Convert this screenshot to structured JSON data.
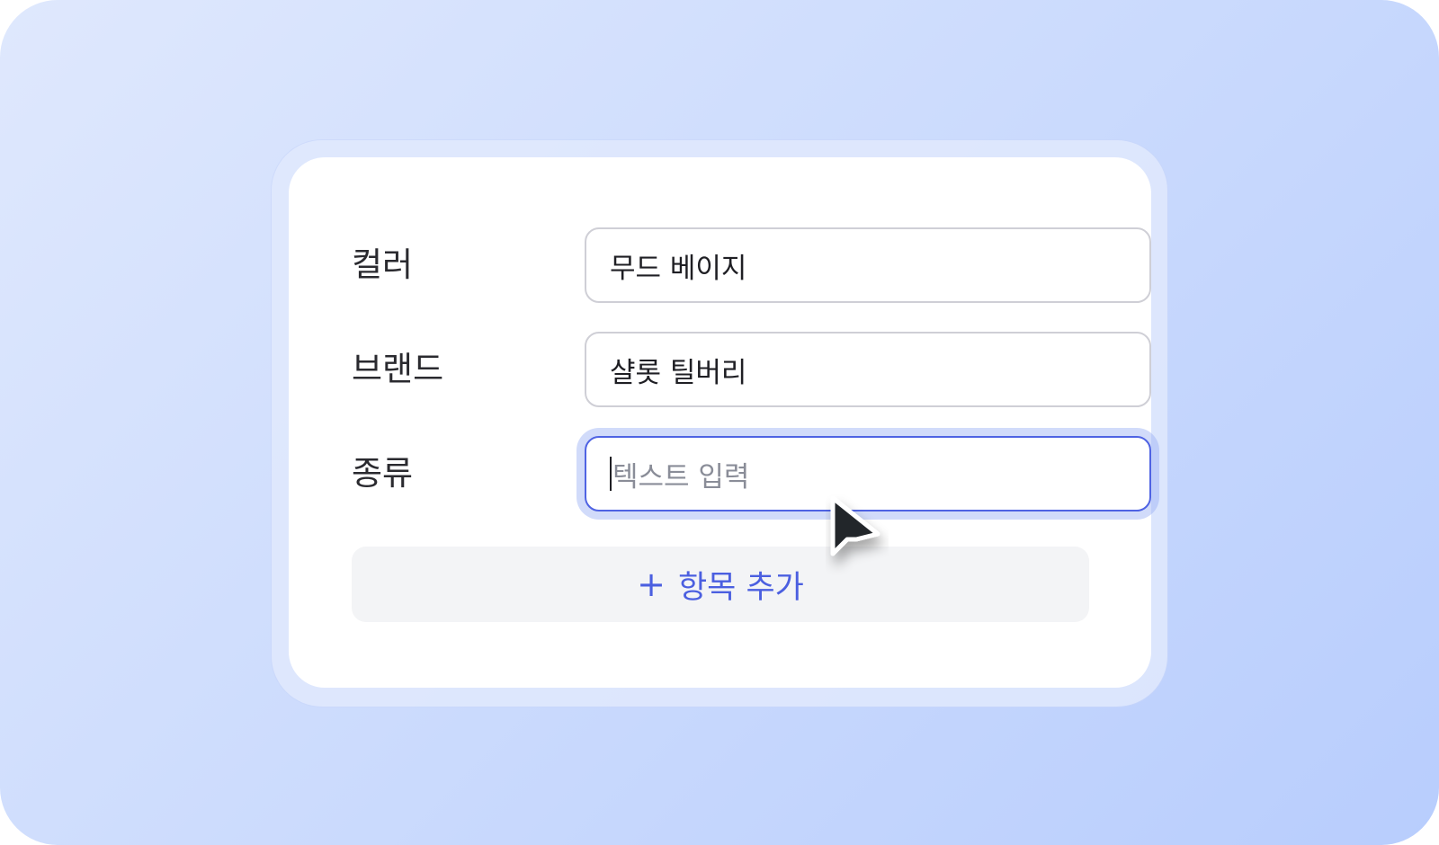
{
  "form": {
    "rows": [
      {
        "label": "컬러",
        "value": "무드 베이지"
      },
      {
        "label": "브랜드",
        "value": "샬롯 틸버리"
      },
      {
        "label": "종류",
        "value": "",
        "placeholder": "텍스트 입력"
      }
    ],
    "add_button": {
      "plus": "+",
      "label": "항목 추가"
    }
  },
  "colors": {
    "accent": "#4f63e3",
    "add_text": "#4b5fe0",
    "background_start": "#dfe8fd",
    "background_end": "#b8cdfd"
  },
  "icons": {
    "cursor": "mouse-pointer-icon"
  }
}
